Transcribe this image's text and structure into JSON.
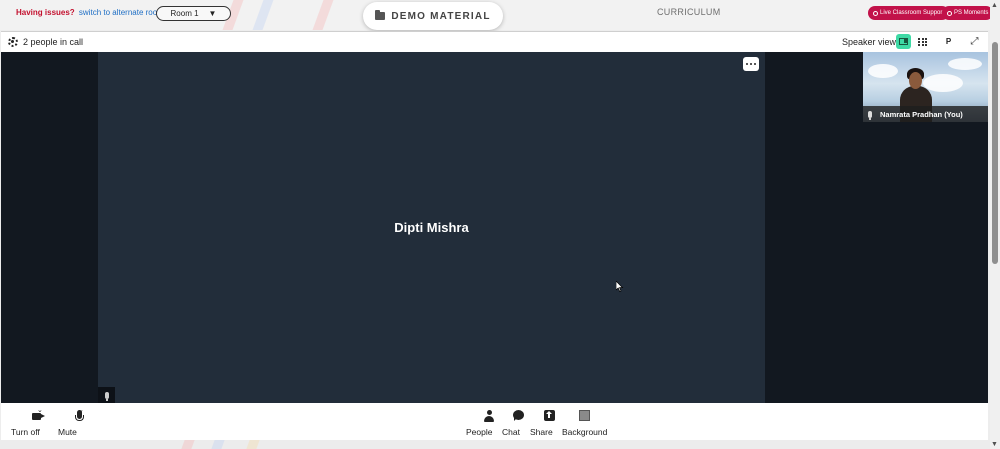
{
  "header": {
    "issue_text": "Having issues?",
    "alt_room_link": "switch to alternate room",
    "room_selected": "Room 1",
    "demo_material_label": "DEMO MATERIAL",
    "curriculum_label": "CURRICULUM",
    "live_support_label": "Live Classroom Support",
    "ps_moments_label": "PS Moments"
  },
  "call": {
    "people_count": "2 people in call",
    "view_label": "Speaker view",
    "p_button": "P",
    "speaker_name": "Dipti Mishra",
    "self_name": "Namrata Pradhan (You)"
  },
  "controls": {
    "camera": "Turn off",
    "mute": "Mute",
    "people": "People",
    "chat": "Chat",
    "share": "Share",
    "background": "Background"
  },
  "colors": {
    "accent_green": "#3ed9a5",
    "brand_red": "#c2124a",
    "tile_bg": "#222d3a",
    "stage_bg": "#121820"
  }
}
